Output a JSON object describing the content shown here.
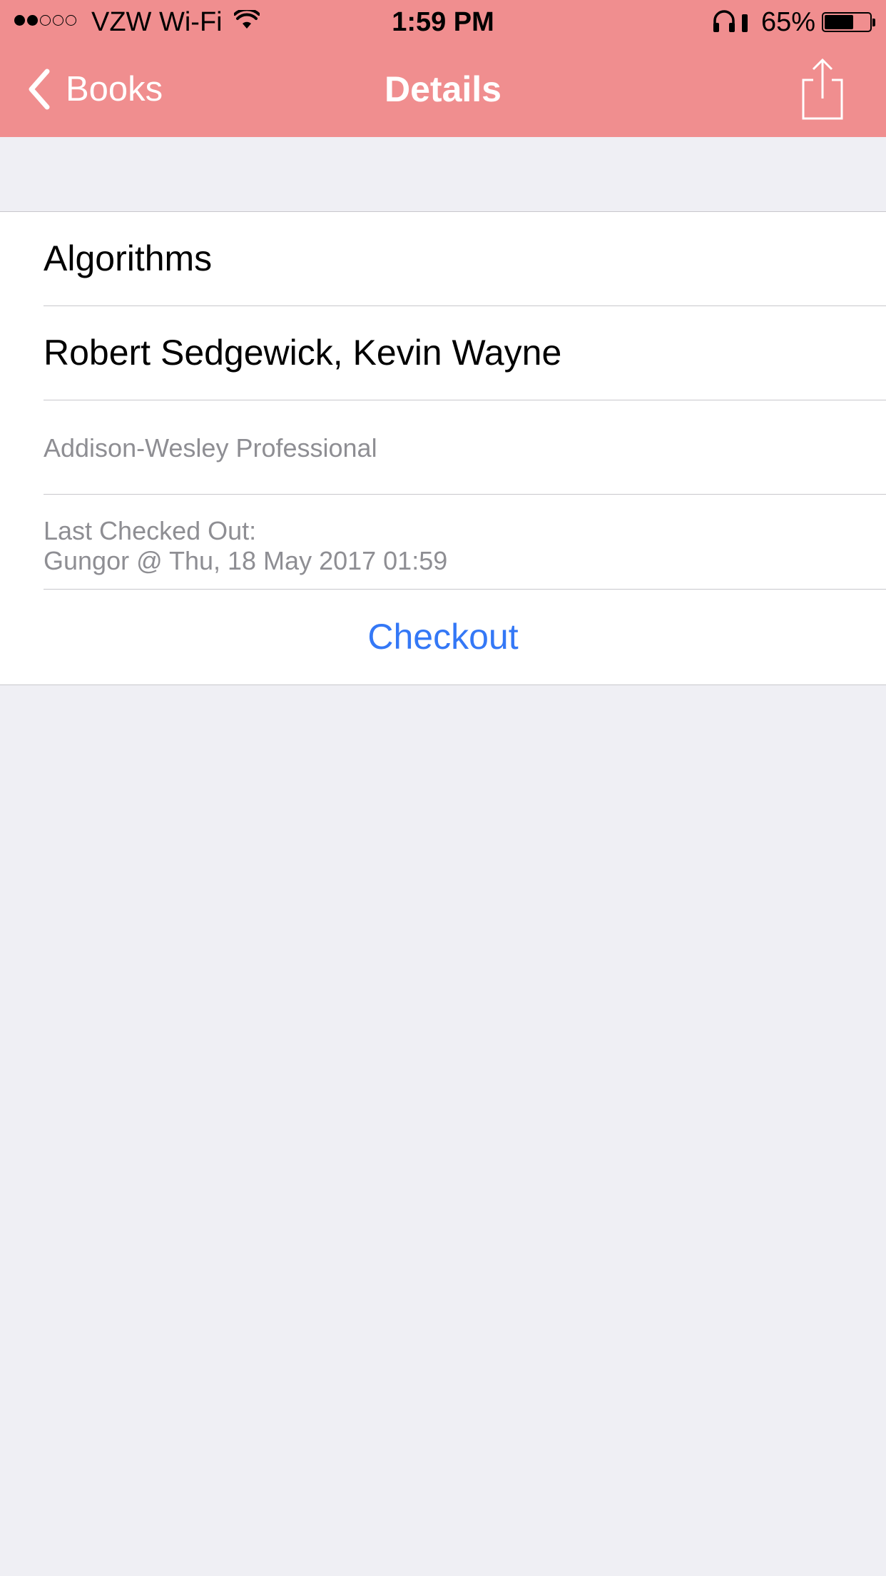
{
  "status_bar": {
    "signal_filled": 2,
    "signal_total": 5,
    "carrier": "VZW Wi-Fi",
    "wifi_icon": "wifi-icon",
    "time": "1:59 PM",
    "headphones_icon": "headphones-icon",
    "battery_percent": "65%",
    "battery_level": 0.65
  },
  "nav": {
    "back_label": "Books",
    "back_icon": "chevron-left-icon",
    "title": "Details",
    "share_icon": "share-icon"
  },
  "book": {
    "title": "Algorithms",
    "authors": "Robert Sedgewick, Kevin Wayne",
    "publisher": "Addison-Wesley Professional",
    "last_checked_out_label": "Last Checked Out:",
    "last_checked_out_value": "Gungor @ Thu, 18 May 2017 01:59"
  },
  "actions": {
    "checkout_label": "Checkout"
  },
  "colors": {
    "nav_background": "#f08e8f",
    "background": "#efeff4",
    "tint": "#3478f6",
    "secondary_text": "#8e8e93",
    "separator": "#c8c7cc"
  }
}
